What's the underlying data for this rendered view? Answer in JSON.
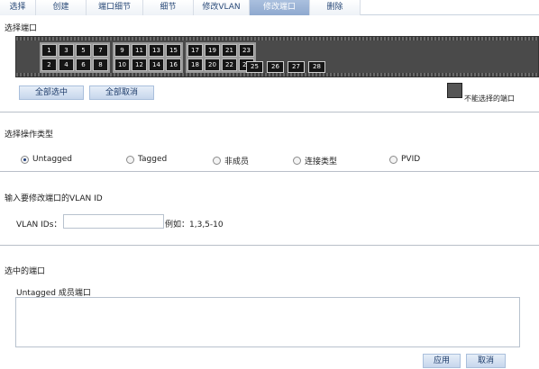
{
  "tabs": [
    {
      "label": "选择"
    },
    {
      "label": "创建"
    },
    {
      "label": "端口细节"
    },
    {
      "label": "细节"
    },
    {
      "label": "修改VLAN"
    },
    {
      "label": "修改端口"
    },
    {
      "label": "删除"
    }
  ],
  "active_tab": "修改端口",
  "port_select": {
    "title": "选择端口",
    "groups": [
      {
        "top": [
          "1",
          "3",
          "5",
          "7"
        ],
        "bottom": [
          "2",
          "4",
          "6",
          "8"
        ]
      },
      {
        "top": [
          "9",
          "11",
          "13",
          "15"
        ],
        "bottom": [
          "10",
          "12",
          "14",
          "16"
        ]
      },
      {
        "top": [
          "17",
          "19",
          "21",
          "23"
        ],
        "bottom": [
          "18",
          "20",
          "22",
          "24"
        ]
      }
    ],
    "sfp_ports": [
      "25",
      "26",
      "27",
      "28"
    ],
    "select_all": "全部选中",
    "deselect_all": "全部取消",
    "legend": "不能选择的端口"
  },
  "operation": {
    "title": "选择操作类型",
    "options": [
      {
        "label": "Untagged",
        "checked": true
      },
      {
        "label": "Tagged",
        "checked": false
      },
      {
        "label": "非成员",
        "checked": false
      },
      {
        "label": "连接类型",
        "checked": false
      },
      {
        "label": "PVID",
        "checked": false
      }
    ]
  },
  "vlan": {
    "title": "输入要修改端口的VLAN ID",
    "label": "VLAN IDs：",
    "value": "",
    "example": "例如：1,3,5-10"
  },
  "selected": {
    "title": "选中的端口",
    "list_label": "Untagged 成员端口",
    "apply": "应用",
    "cancel": "取消"
  },
  "colors": {
    "accent": "#8fa9cf",
    "button": "#c6d6ec",
    "panel": "#4a4a4a"
  }
}
